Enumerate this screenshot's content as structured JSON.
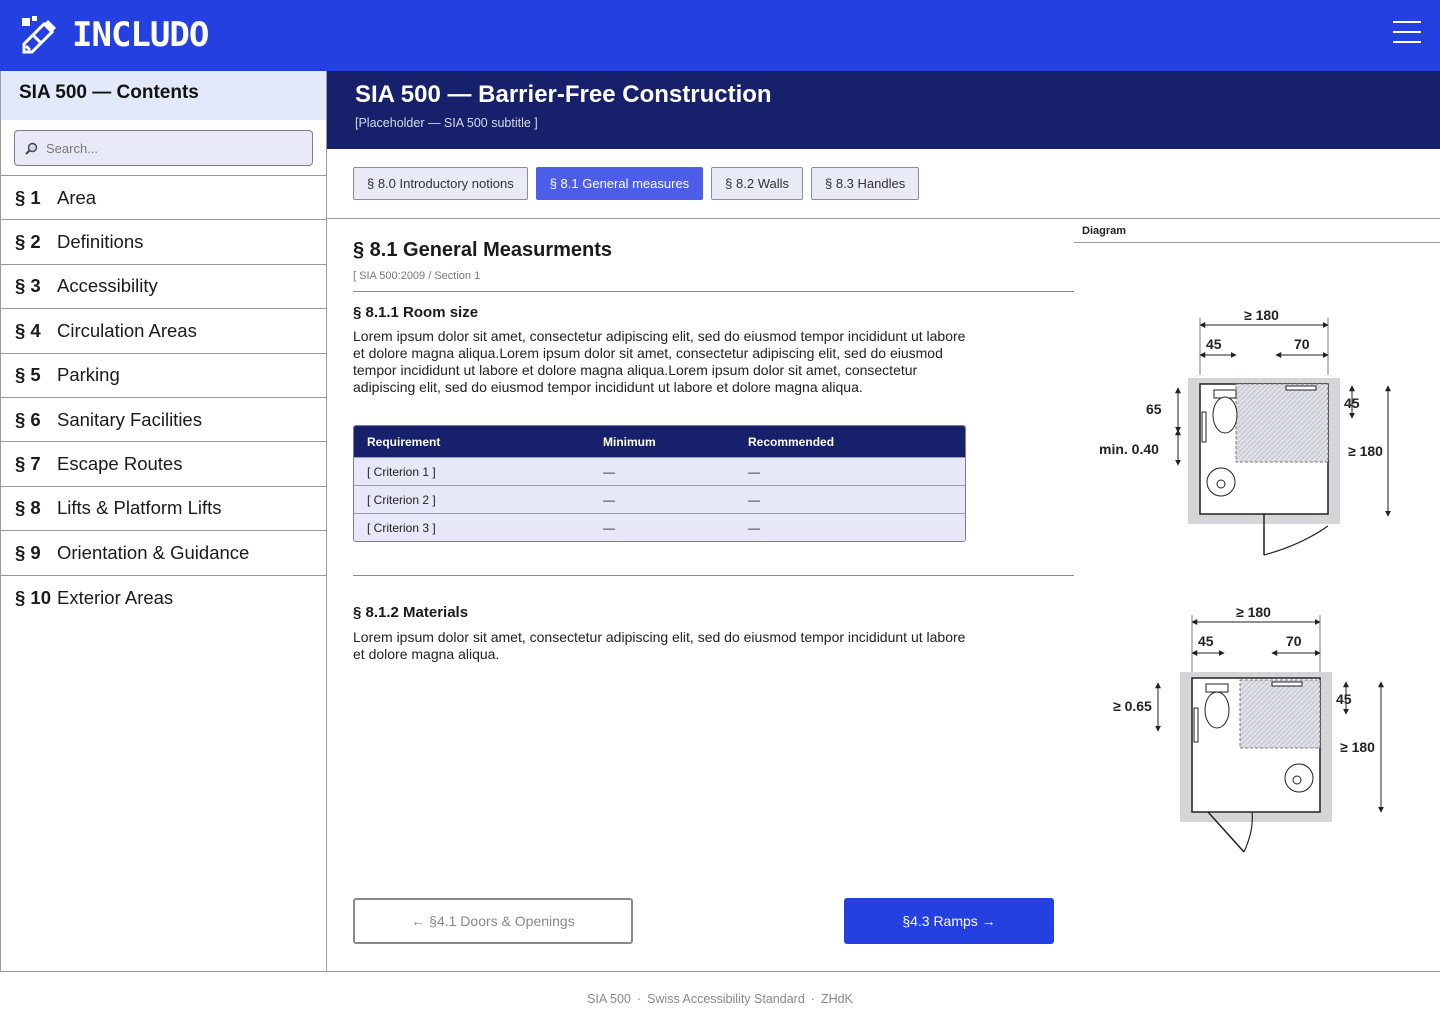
{
  "app": {
    "logo_text": "INCLUDO",
    "menu_icon": "hamburger-menu-icon"
  },
  "sidebar": {
    "title": "SIA 500 — Contents",
    "search_placeholder": "Search...",
    "items": [
      {
        "num": "§ 1",
        "label": "Area"
      },
      {
        "num": "§ 2",
        "label": "Definitions"
      },
      {
        "num": "§ 3",
        "label": "Accessibility"
      },
      {
        "num": "§ 4",
        "label": "Circulation Areas"
      },
      {
        "num": "§ 5",
        "label": "Parking"
      },
      {
        "num": "§ 6",
        "label": "Sanitary Facilities"
      },
      {
        "num": "§ 7",
        "label": "Escape Routes"
      },
      {
        "num": "§ 8",
        "label": "Lifts & Platform Lifts"
      },
      {
        "num": "§ 9",
        "label": "Orientation & Guidance"
      },
      {
        "num": "§ 10",
        "label": "Exterior Areas"
      }
    ]
  },
  "header": {
    "title": "SIA 500 — Barrier-Free Construction",
    "subtitle": "[Placeholder — SIA 500 subtitle ]"
  },
  "tabs": [
    {
      "label": "§ 8.0  Introductory notions",
      "active": false
    },
    {
      "label": "§ 8.1  General measures",
      "active": true
    },
    {
      "label": "§ 8.2 Walls",
      "active": false
    },
    {
      "label": "§ 8.3 Handles",
      "active": false
    }
  ],
  "section": {
    "title": "§ 8.1  General Measurments",
    "source": "[ SIA 500:2009 / Section 1",
    "subsections": [
      {
        "title": "§ 8.1.1  Room size",
        "text": "Lorem ipsum dolor sit amet, consectetur adipiscing elit, sed do eiusmod tempor incididunt ut labore et dolore magna aliqua.Lorem ipsum dolor sit amet, consectetur adipiscing elit, sed do eiusmod tempor incididunt ut labore et dolore magna aliqua.Lorem ipsum dolor sit amet, consectetur adipiscing elit, sed do eiusmod tempor incididunt ut labore et dolore magna aliqua."
      },
      {
        "title": "§ 8.1.2  Materials",
        "text": "Lorem ipsum dolor sit amet, consectetur adipiscing elit, sed do eiusmod tempor incididunt ut labore et dolore magna aliqua."
      }
    ],
    "table": {
      "headers": [
        "Requirement",
        "Minimum",
        "Recommended"
      ],
      "rows": [
        [
          "[ Criterion 1 ]",
          "—",
          "—"
        ],
        [
          "[ Criterion 2 ]",
          "—",
          "—"
        ],
        [
          "[ Criterion 3 ]",
          "—",
          "—"
        ]
      ]
    }
  },
  "diagram": {
    "label": "Diagram",
    "top": {
      "width": "≥ 180",
      "left": "45",
      "right": "70",
      "side_a": "65",
      "side_b": "min. 0.40",
      "right_a": "45",
      "right_b": "≥ 180"
    },
    "bottom": {
      "width": "≥ 180",
      "left": "45",
      "right": "70",
      "side_a": "≥ 0.65",
      "right_a": "45",
      "right_b": "≥ 180"
    }
  },
  "nav": {
    "prev": "← §4.1 Doors & Openings",
    "next": "§4.3 Ramps →"
  },
  "footer": {
    "parts": [
      "SIA 500",
      "Swiss Accessibility Standard",
      "ZHdK"
    ]
  },
  "colors": {
    "brand": "#2440e0",
    "header_dark": "#17216b",
    "tab_active": "#4c5ee8",
    "sidebar_header": "#e4e8fb"
  }
}
